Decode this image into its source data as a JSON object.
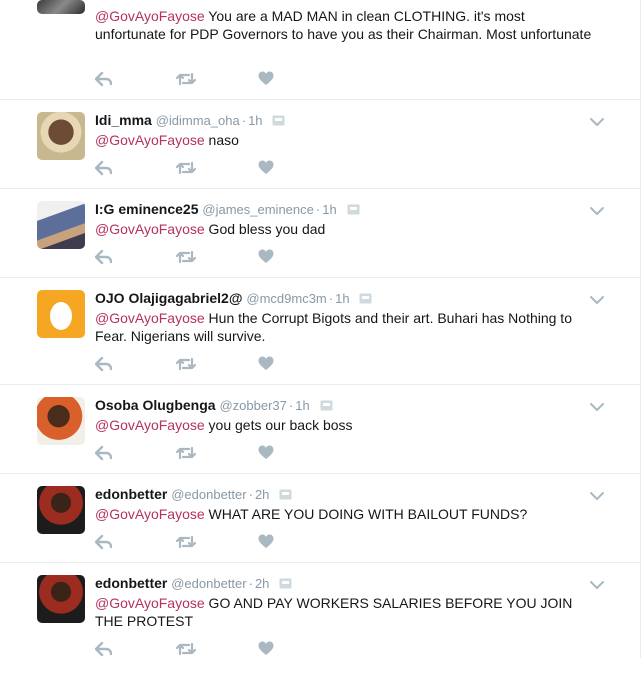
{
  "tweets": [
    {
      "name": "",
      "handle": "",
      "time": "",
      "mention": "@GovAyoFayose",
      "text": " You are a MAD MAN in clean CLOTHING.  it's most unfortunate for PDP Governors to have you as their Chairman.  Most unfortunate"
    },
    {
      "name": "Idi_mma",
      "handle": "@idimma_oha",
      "dot": "·",
      "time": "1h",
      "mention": "@GovAyoFayose",
      "text": " naso"
    },
    {
      "name": "I:G eminence25",
      "handle": "@james_eminence",
      "dot": "·",
      "time": "1h",
      "mention": "@GovAyoFayose",
      "text": " God bless you dad"
    },
    {
      "name": "OJO Olajigagabriel2@",
      "handle": "@mcd9mc3m",
      "dot": "·",
      "time": "1h",
      "mention": "@GovAyoFayose",
      "text": " Hun the Corrupt Bigots and their art. Buhari has Nothing to Fear. Nigerians will survive."
    },
    {
      "name": "Osoba Olugbenga",
      "handle": "@zobber37",
      "dot": "·",
      "time": "1h",
      "mention": "@GovAyoFayose",
      "text": " you gets our back boss"
    },
    {
      "name": "edonbetter",
      "handle": "@edonbetter",
      "dot": "·",
      "time": "2h",
      "mention": "@GovAyoFayose",
      "text": " WHAT ARE YOU DOING WITH BAILOUT FUNDS?"
    },
    {
      "name": "edonbetter",
      "handle": "@edonbetter",
      "dot": "·",
      "time": "2h",
      "mention": "@GovAyoFayose",
      "text": " GO AND PAY WORKERS SALARIES BEFORE YOU JOIN THE PROTEST"
    }
  ],
  "icons": {
    "reply": "reply-icon",
    "retweet": "retweet-icon",
    "like": "heart-icon",
    "more": "chevron-down-icon",
    "badge": "mobile-badge-icon"
  },
  "colors": {
    "mention": "#b5325d",
    "muted": "#8899a6",
    "action": "#aab8c2",
    "divider": "#e6ecf0"
  }
}
